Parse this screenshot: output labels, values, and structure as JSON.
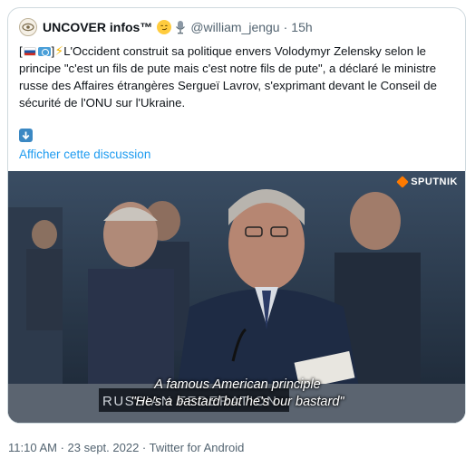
{
  "tweet": {
    "author_name": "UNCOVER infos™",
    "handle": "@william_jengu",
    "separator": "·",
    "relative_time": "15h",
    "text_open_bracket": "[",
    "text_close_bracket": "]",
    "flag_left": "russia-flag",
    "flag_right": "un-flag",
    "text": "L'Occident construit sa politique envers Volodymyr Zelensky selon le principe \"c'est un fils de pute mais c'est notre fils de pute\", a déclaré le ministre russe des Affaires étrangères Sergueï Lavrov, s'exprimant devant le Conseil de sécurité de l'ONU sur l'Ukraine.",
    "show_thread_label": "Afficher cette discussion"
  },
  "media": {
    "watermark": "SPUTNIK",
    "subtitle_line1": "A famous American principle",
    "subtitle_line2": "\"He's a bastard but he's our bastard\"",
    "desk_plate": "RUSSIAN FEDERATION"
  },
  "footer": {
    "meta": "11:10 AM · 23 sept. 2022 · Twitter for Android"
  },
  "colors": {
    "link": "#1d9bf0",
    "muted": "#536471",
    "border": "#cfd9de"
  }
}
